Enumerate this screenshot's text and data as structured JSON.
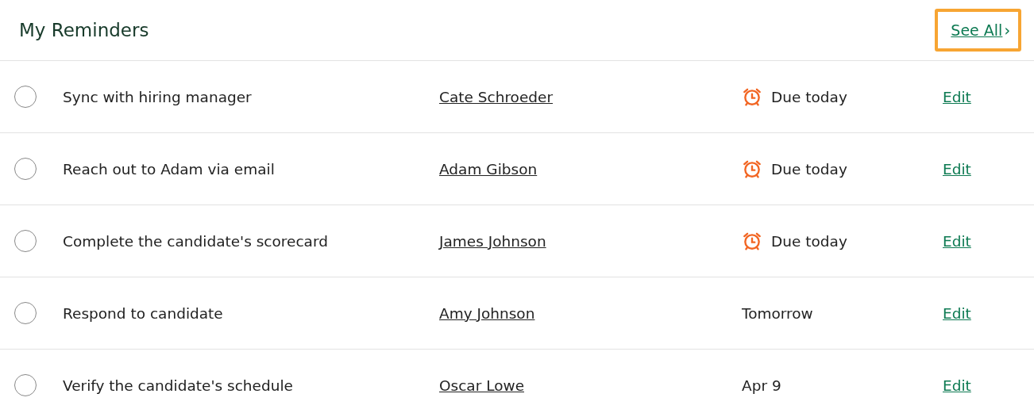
{
  "header": {
    "title": "My Reminders",
    "see_all": {
      "label": "See All",
      "chevron": "›",
      "focused": true
    }
  },
  "reminders": [
    {
      "checked": false,
      "task": "Sync with hiring manager",
      "person": "Cate Schroeder",
      "due": {
        "kind": "alarm",
        "text": "Due today"
      },
      "action": "Edit"
    },
    {
      "checked": false,
      "task": "Reach out to Adam via email",
      "person": "Adam Gibson",
      "due": {
        "kind": "alarm",
        "text": "Due today"
      },
      "action": "Edit"
    },
    {
      "checked": false,
      "task": "Complete the candidate's scorecard",
      "person": "James Johnson",
      "due": {
        "kind": "alarm",
        "text": "Due today"
      },
      "action": "Edit"
    },
    {
      "checked": false,
      "task": "Respond to candidate",
      "person": "Amy Johnson",
      "due": {
        "kind": "plain",
        "text": "Tomorrow"
      },
      "action": "Edit"
    },
    {
      "checked": false,
      "task": "Verify the candidate's schedule",
      "person": "Oscar Lowe",
      "due": {
        "kind": "plain",
        "text": "Apr 9"
      },
      "action": "Edit"
    }
  ]
}
